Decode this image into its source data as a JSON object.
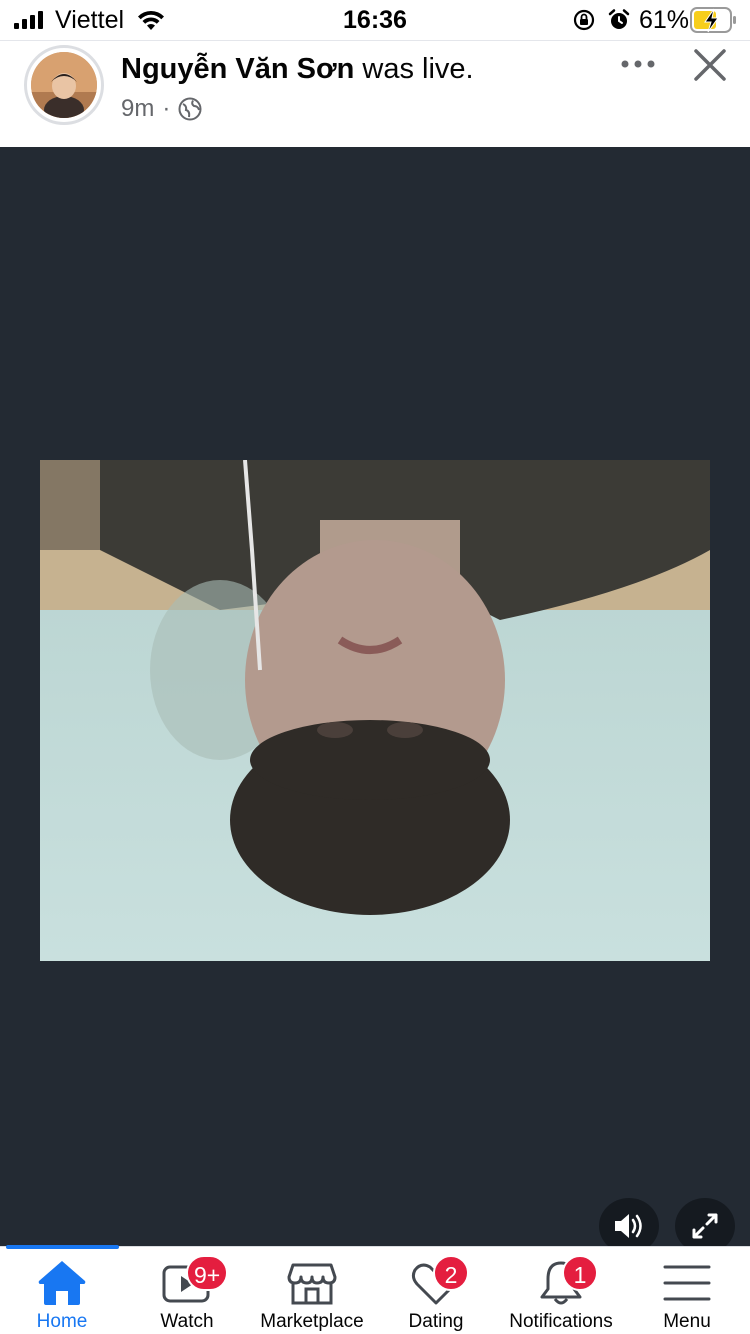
{
  "status_bar": {
    "carrier": "Viettel",
    "time": "16:36",
    "battery_percent": "61%"
  },
  "post": {
    "author_name": "Nguyễn Văn Sơn",
    "action": "was live.",
    "time_ago": "9m",
    "separator": "·",
    "privacy_icon": "globe-icon"
  },
  "video": {
    "controls": [
      "volume-icon",
      "fullscreen-icon"
    ]
  },
  "tab_bar": {
    "tabs": [
      {
        "label": "Home",
        "icon": "home-icon",
        "active": true,
        "badge": ""
      },
      {
        "label": "Watch",
        "icon": "watch-icon",
        "active": false,
        "badge": "9+"
      },
      {
        "label": "Marketplace",
        "icon": "marketplace-icon",
        "active": false,
        "badge": ""
      },
      {
        "label": "Dating",
        "icon": "heart-icon",
        "active": false,
        "badge": "2"
      },
      {
        "label": "Notifications",
        "icon": "bell-icon",
        "active": false,
        "badge": "1"
      },
      {
        "label": "Menu",
        "icon": "menu-icon",
        "active": false,
        "badge": ""
      }
    ]
  },
  "colors": {
    "accent": "#1877f2",
    "badge": "#e41e3f",
    "video_background": "#232a33",
    "secondary_text": "#65676b"
  }
}
